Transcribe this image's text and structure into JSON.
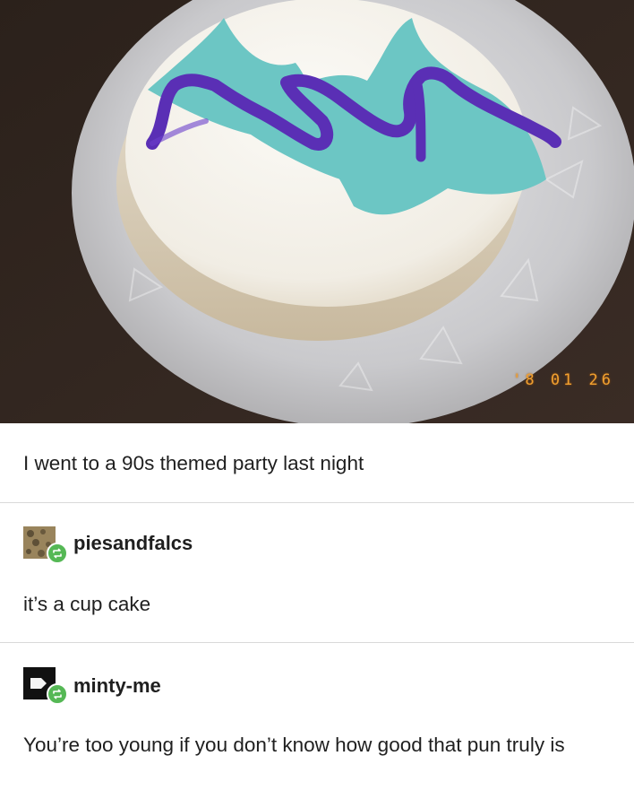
{
  "post": {
    "photo_timestamp": "'8 01 26",
    "caption": "I went to a 90s themed party last night"
  },
  "replies": [
    {
      "username": "piesandfalcs",
      "text": "it’s a cup cake"
    },
    {
      "username": "minty-me",
      "text": "You’re too young if you don’t know how good that pun truly is"
    }
  ],
  "colors": {
    "reblog_badge": "#55b855",
    "frosting_teal": "#6cc6c4",
    "frosting_purple": "#5a2fb5",
    "timestamp": "#f0a030"
  },
  "icons": {
    "reblog": "reblog-icon"
  }
}
